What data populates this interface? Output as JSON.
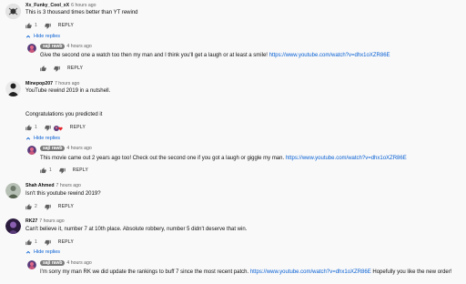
{
  "labels": {
    "reply": "REPLY",
    "hide_replies": "Hide replies"
  },
  "colors": {
    "background": "#f9f9f9",
    "link": "#065fd4",
    "meta": "#606060",
    "chip": "#7a7a7a"
  },
  "comments": [
    {
      "author": "Xx_Funky_Cool_xX",
      "time": "6 hours ago",
      "text": "This is 3 thousand times better than YT rewind",
      "likes": "1",
      "replies": [
        {
          "author": "saji rawb",
          "time": "4 hours ago",
          "text": "Give the second one a watch too then my man and I think you'll get a laugh or at least a smile! ",
          "link": "https://www.youtube.com/watch?v=dhx1oXZR86E",
          "likes": ""
        }
      ]
    },
    {
      "author": "Minepop207",
      "time": "7 hours ago",
      "text_line1": "YouTube rewind 2019 in a nutshell.",
      "text_line2": "Congratulations you predicted it",
      "likes": "1",
      "replies": [
        {
          "author": "saji rawb",
          "time": "4 hours ago",
          "text": "This movie came out 2 years ago too! Check out the second one if you got a laugh or giggle my man. ",
          "link": "https://www.youtube.com/watch?v=dhx1oXZR86E",
          "likes": "1"
        }
      ]
    },
    {
      "author": "Shah Ahmed",
      "time": "7 hours ago",
      "text": "Isn't this youtube rewind 2019?",
      "likes": "2"
    },
    {
      "author": "RK27",
      "time": "7 hours ago",
      "text": "Can't believe it, number 7 at 10th place. Absolute robbery, number 5 didn't deserve that win.",
      "likes": "1",
      "replies": [
        {
          "author": "saji rawb",
          "time": "4 hours ago",
          "text_before": "I'm sorry my man RK we did update the rankings to buff 7 since the most recent patch. ",
          "link": "https://www.youtube.com/watch?v=dhx1oXZR86E",
          "text_after": " Hopefully you like the new order!"
        }
      ]
    }
  ]
}
